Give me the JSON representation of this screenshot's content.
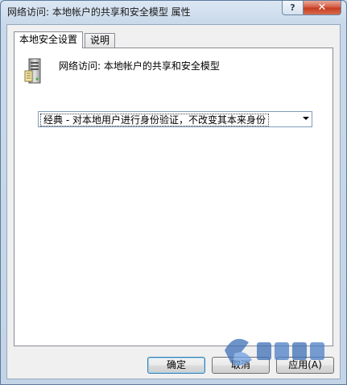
{
  "window": {
    "title": "网络访问: 本地帐户的共享和安全模型 属性",
    "help_label": "?",
    "close_label": "✕"
  },
  "tabs": [
    {
      "label": "本地安全设置",
      "active": true
    },
    {
      "label": "说明",
      "active": false
    }
  ],
  "policy": {
    "name": "网络访问: 本地帐户的共享和安全模型",
    "icon": "server-icon"
  },
  "dropdown": {
    "selected": "经典 - 对本地用户进行身份验证，不改变其本来身份"
  },
  "buttons": {
    "ok": "确定",
    "cancel": "取消",
    "apply": "应用(A)"
  },
  "colors": {
    "title_bar": "#c9d9ea",
    "close_button": "#c43a20",
    "default_button_border": "#3c7fb1"
  }
}
